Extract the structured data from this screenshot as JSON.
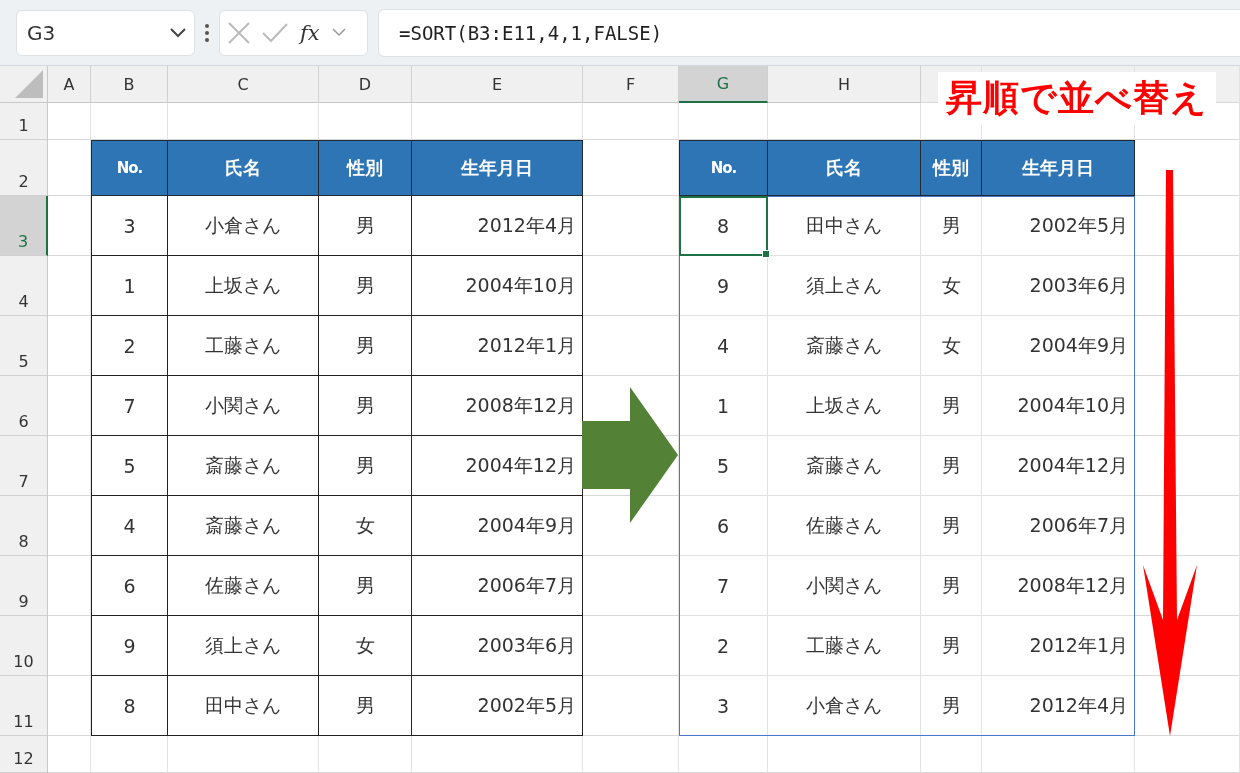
{
  "formula_bar": {
    "name_box": "G3",
    "function_button": "fx",
    "formula": "=SORT(B3:E11,4,1,FALSE)"
  },
  "column_headers": [
    {
      "label": "A",
      "selected": false
    },
    {
      "label": "B",
      "selected": false
    },
    {
      "label": "C",
      "selected": false
    },
    {
      "label": "D",
      "selected": false
    },
    {
      "label": "E",
      "selected": false
    },
    {
      "label": "F",
      "selected": false
    },
    {
      "label": "G",
      "selected": true
    },
    {
      "label": "H",
      "selected": false
    }
  ],
  "row_headers": [
    {
      "label": "1",
      "selected": false
    },
    {
      "label": "2",
      "selected": false
    },
    {
      "label": "3",
      "selected": true
    },
    {
      "label": "4",
      "selected": false
    },
    {
      "label": "5",
      "selected": false
    },
    {
      "label": "6",
      "selected": false
    },
    {
      "label": "7",
      "selected": false
    },
    {
      "label": "8",
      "selected": false
    },
    {
      "label": "9",
      "selected": false
    },
    {
      "label": "10",
      "selected": false
    },
    {
      "label": "11",
      "selected": false
    },
    {
      "label": "12",
      "selected": false
    }
  ],
  "source_table": {
    "columns": [
      "No.",
      "氏名",
      "性別",
      "生年月日"
    ],
    "rows": [
      {
        "cells": [
          "3",
          "小倉さん",
          "男",
          "2012年4月"
        ],
        "selected": false
      },
      {
        "cells": [
          "1",
          "上坂さん",
          "男",
          "2004年10月"
        ],
        "selected": false
      },
      {
        "cells": [
          "2",
          "工藤さん",
          "男",
          "2012年1月"
        ],
        "selected": false
      },
      {
        "cells": [
          "7",
          "小関さん",
          "男",
          "2008年12月"
        ],
        "selected": false
      },
      {
        "cells": [
          "5",
          "斎藤さん",
          "男",
          "2004年12月"
        ],
        "selected": false
      },
      {
        "cells": [
          "4",
          "斎藤さん",
          "女",
          "2004年9月"
        ],
        "selected": false
      },
      {
        "cells": [
          "6",
          "佐藤さん",
          "男",
          "2006年7月"
        ],
        "selected": false
      },
      {
        "cells": [
          "9",
          "須上さん",
          "女",
          "2003年6月"
        ],
        "selected": false
      },
      {
        "cells": [
          "8",
          "田中さん",
          "男",
          "2002年5月"
        ],
        "selected": false
      }
    ]
  },
  "sorted_table": {
    "columns": [
      "No.",
      "氏名",
      "性別",
      "生年月日"
    ],
    "rows": [
      {
        "cells": [
          "8",
          "田中さん",
          "男",
          "2002年5月"
        ],
        "selected": true
      },
      {
        "cells": [
          "9",
          "須上さん",
          "女",
          "2003年6月"
        ],
        "selected": false
      },
      {
        "cells": [
          "4",
          "斎藤さん",
          "女",
          "2004年9月"
        ],
        "selected": false
      },
      {
        "cells": [
          "1",
          "上坂さん",
          "男",
          "2004年10月"
        ],
        "selected": false
      },
      {
        "cells": [
          "5",
          "斎藤さん",
          "男",
          "2004年12月"
        ],
        "selected": false
      },
      {
        "cells": [
          "6",
          "佐藤さん",
          "男",
          "2006年7月"
        ],
        "selected": false
      },
      {
        "cells": [
          "7",
          "小関さん",
          "男",
          "2008年12月"
        ],
        "selected": false
      },
      {
        "cells": [
          "2",
          "工藤さん",
          "男",
          "2012年1月"
        ],
        "selected": false
      },
      {
        "cells": [
          "3",
          "小倉さん",
          "男",
          "2012年4月"
        ],
        "selected": false
      }
    ]
  },
  "callout": "昇順で並べ替え"
}
